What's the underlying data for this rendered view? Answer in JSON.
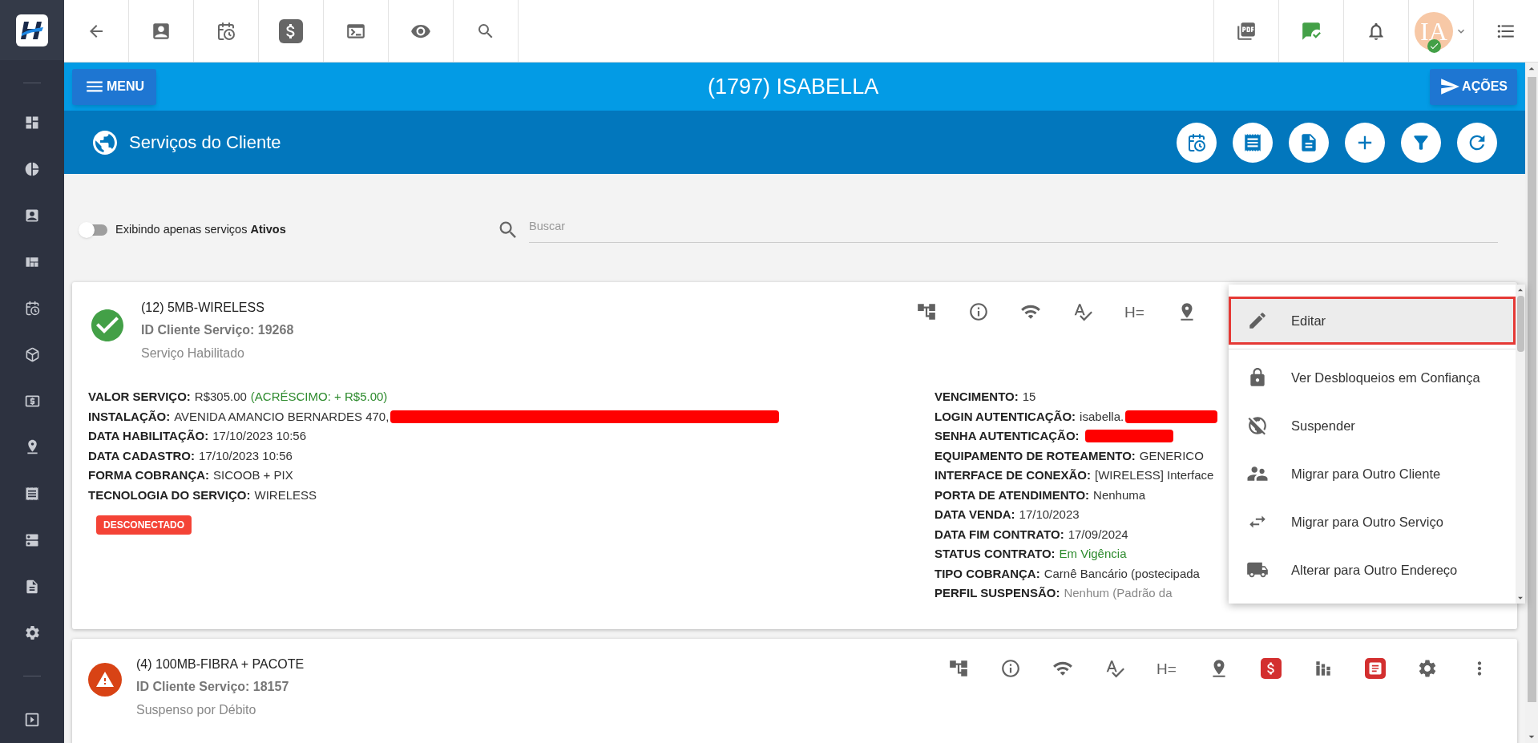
{
  "user": {
    "avatar_initials": "IA",
    "online": true
  },
  "header": {
    "menu_button": "MENU",
    "title": "(1797) ISABELLA",
    "actions_button": "AÇÕES"
  },
  "section": {
    "title": "Serviços do Cliente"
  },
  "filter": {
    "toggle": {
      "on": false,
      "label": "Exibindo apenas serviços **Ativos**"
    },
    "search": {
      "placeholder": "Buscar"
    }
  },
  "services": [
    {
      "kind": "ok",
      "title": "(12) 5MB-WIRELESS",
      "id_text": "ID Cliente Serviço: 19268",
      "status_text": "Serviço Habilitado",
      "spacing_glyph": "H=",
      "details_left": [
        {
          "label": "VALOR SERVIÇO:",
          "value": "R$305.00",
          "extra": "(ACRÉSCIMO: + R$5.00)"
        },
        {
          "label": "INSTALAÇÃO:",
          "value": "AVENIDA AMANCIO BERNARDES 470,",
          "redacted": true
        },
        {
          "label": "DATA HABILITAÇÃO:",
          "value": "17/10/2023 10:56"
        },
        {
          "label": "DATA CADASTRO:",
          "value": "17/10/2023 10:56"
        },
        {
          "label": "FORMA COBRANÇA:",
          "value": "SICOOB + PIX"
        },
        {
          "label": "TECNOLOGIA DO SERVIÇO:",
          "value": "WIRELESS"
        }
      ],
      "badge": "DESCONECTADO",
      "details_right": [
        {
          "label": "VENCIMENTO:",
          "value": "15"
        },
        {
          "label": "LOGIN AUTENTICAÇÃO:",
          "value": "isabella.",
          "redacted": true
        },
        {
          "label": "SENHA AUTENTICAÇÃO:",
          "redacted": true
        },
        {
          "label": "EQUIPAMENTO DE ROTEAMENTO:",
          "value": "GENERICO"
        },
        {
          "label": "INTERFACE DE CONEXÃO:",
          "value": "[WIRELESS] Interface"
        },
        {
          "label": "PORTA DE ATENDIMENTO:",
          "value": "Nenhuma"
        },
        {
          "label": "DATA VENDA:",
          "value": "17/10/2023"
        },
        {
          "label": "DATA FIM CONTRATO:",
          "value": "17/09/2024"
        },
        {
          "label": "STATUS CONTRATO:",
          "value": "Em Vigência",
          "kind": "positive"
        },
        {
          "label": "TIPO COBRANÇA:",
          "value": "Carnê Bancário (postecipada"
        },
        {
          "label": "PERFIL SUSPENSÃO:",
          "value": "Nenhum (Padrão da",
          "kind": "muted"
        }
      ],
      "menu": {
        "items": [
          {
            "kind": "edit",
            "label": "Editar",
            "selected": true
          },
          {
            "kind": "lock",
            "label": "Ver Desbloqueios em Confiança",
            "selected": false
          },
          {
            "kind": "suspend",
            "label": "Suspender",
            "selected": false
          },
          {
            "kind": "people",
            "label": "Migrar para Outro Cliente",
            "selected": false
          },
          {
            "kind": "swap",
            "label": "Migrar para Outro Serviço",
            "selected": false
          },
          {
            "kind": "truck",
            "label": "Alterar para Outro Endereço",
            "selected": false
          }
        ]
      }
    },
    {
      "kind": "warning",
      "title": "(4) 100MB-FIBRA + PACOTE",
      "id_text": "ID Cliente Serviço: 18157",
      "status_text": "Suspenso por Débito",
      "spacing_glyph": "H="
    }
  ]
}
